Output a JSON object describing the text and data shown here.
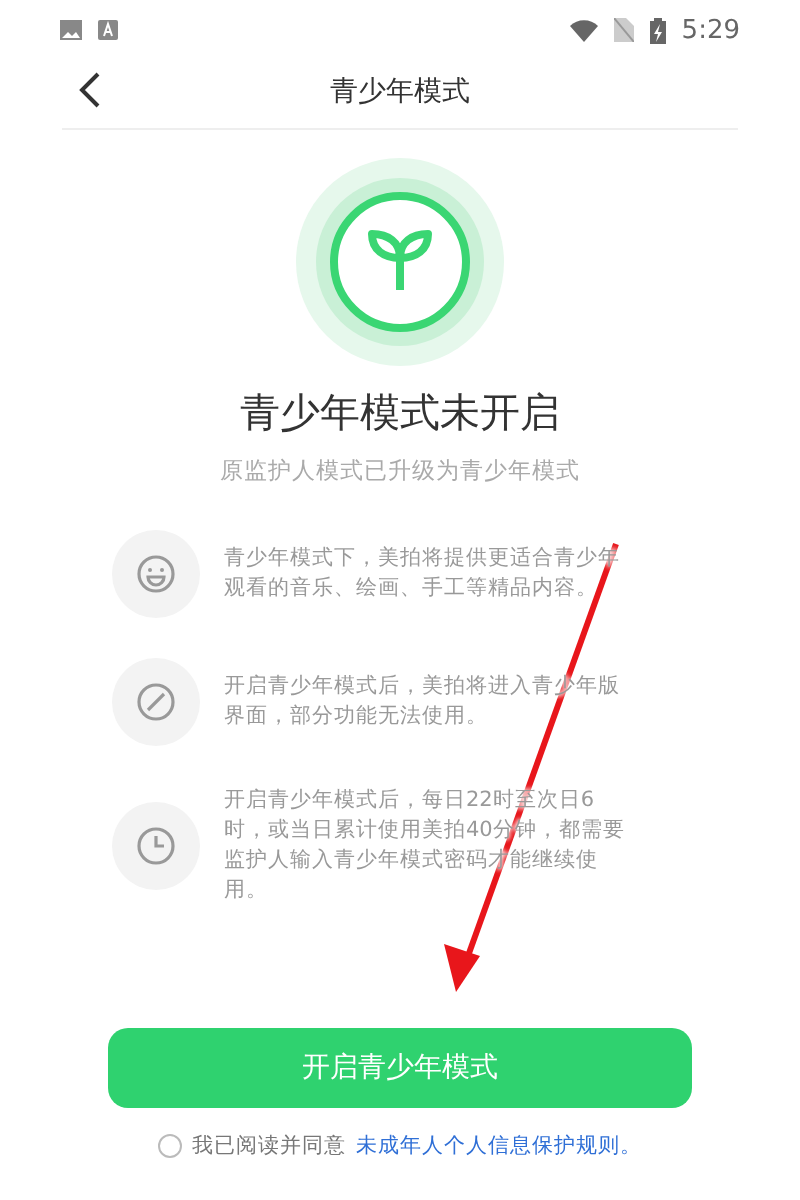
{
  "status_bar": {
    "time": "5:29"
  },
  "header": {
    "title": "青少年模式"
  },
  "hero": {
    "title": "青少年模式未开启",
    "subtitle": "原监护人模式已升级为青少年模式"
  },
  "features": [
    {
      "kind": "smile",
      "text": "青少年模式下，美拍将提供更适合青少年观看的音乐、绘画、手工等精品内容。"
    },
    {
      "kind": "ban",
      "text": "开启青少年模式后，美拍将进入青少年版界面，部分功能无法使用。"
    },
    {
      "kind": "clock",
      "text": "开启青少年模式后，每日22时至次日6时，或当日累计使用美拍40分钟，都需要监护人输入青少年模式密码才能继续使用。"
    }
  ],
  "button": {
    "label": "开启青少年模式"
  },
  "agreement": {
    "checked": false,
    "text": "我已阅读并同意",
    "link": "未成年人个人信息保护规则。"
  }
}
